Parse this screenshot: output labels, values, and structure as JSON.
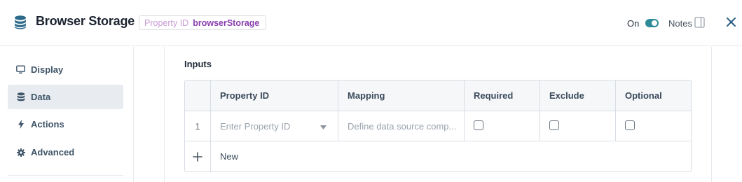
{
  "header": {
    "icon": "database-icon",
    "title": "Browser Storage",
    "property_id_key": "Property ID",
    "property_id_value": "browserStorage",
    "toggle_label": "On",
    "toggle_on": true,
    "notes_label": "Notes",
    "accent": "#2d8b99"
  },
  "sidebar": {
    "items": [
      {
        "label": "Display",
        "icon": "monitor-icon",
        "active": false
      },
      {
        "label": "Data",
        "icon": "database-icon",
        "active": true
      },
      {
        "label": "Actions",
        "icon": "lightning-icon",
        "active": false
      },
      {
        "label": "Advanced",
        "icon": "gear-icon",
        "active": false
      }
    ]
  },
  "inputs": {
    "section_title": "Inputs",
    "columns": [
      "Property ID",
      "Mapping",
      "Required",
      "Exclude",
      "Optional"
    ],
    "rows": [
      {
        "index": "1",
        "property_id_placeholder": "Enter Property ID",
        "mapping_placeholder": "Define data source comp...",
        "required": false,
        "exclude": false,
        "optional": false
      }
    ],
    "new_label": "New"
  }
}
